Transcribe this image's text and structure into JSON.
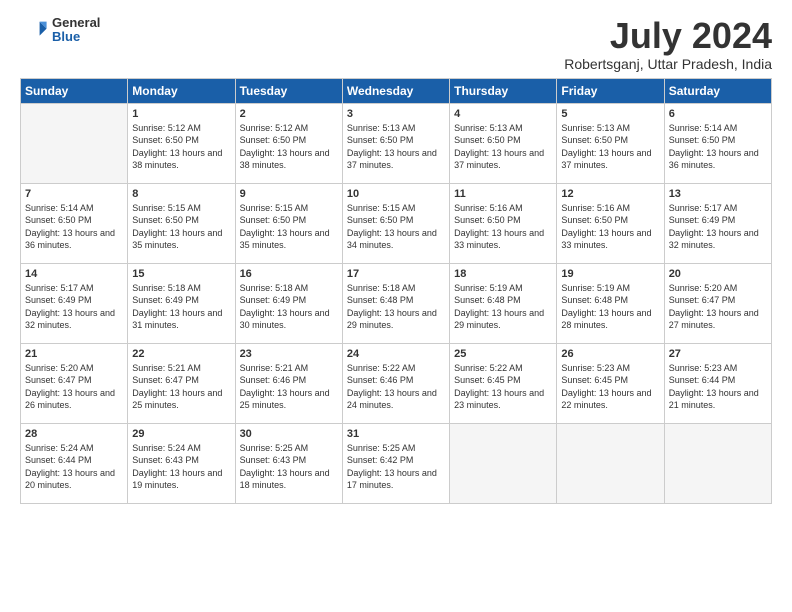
{
  "header": {
    "logo_general": "General",
    "logo_blue": "Blue",
    "title": "July 2024",
    "subtitle": "Robertsganj, Uttar Pradesh, India"
  },
  "days_of_week": [
    "Sunday",
    "Monday",
    "Tuesday",
    "Wednesday",
    "Thursday",
    "Friday",
    "Saturday"
  ],
  "weeks": [
    [
      {
        "day": "",
        "empty": true
      },
      {
        "day": "1",
        "sunrise": "5:12 AM",
        "sunset": "6:50 PM",
        "daylight": "13 hours and 38 minutes."
      },
      {
        "day": "2",
        "sunrise": "5:12 AM",
        "sunset": "6:50 PM",
        "daylight": "13 hours and 38 minutes."
      },
      {
        "day": "3",
        "sunrise": "5:13 AM",
        "sunset": "6:50 PM",
        "daylight": "13 hours and 37 minutes."
      },
      {
        "day": "4",
        "sunrise": "5:13 AM",
        "sunset": "6:50 PM",
        "daylight": "13 hours and 37 minutes."
      },
      {
        "day": "5",
        "sunrise": "5:13 AM",
        "sunset": "6:50 PM",
        "daylight": "13 hours and 37 minutes."
      },
      {
        "day": "6",
        "sunrise": "5:14 AM",
        "sunset": "6:50 PM",
        "daylight": "13 hours and 36 minutes."
      }
    ],
    [
      {
        "day": "7",
        "sunrise": "5:14 AM",
        "sunset": "6:50 PM",
        "daylight": "13 hours and 36 minutes."
      },
      {
        "day": "8",
        "sunrise": "5:15 AM",
        "sunset": "6:50 PM",
        "daylight": "13 hours and 35 minutes."
      },
      {
        "day": "9",
        "sunrise": "5:15 AM",
        "sunset": "6:50 PM",
        "daylight": "13 hours and 35 minutes."
      },
      {
        "day": "10",
        "sunrise": "5:15 AM",
        "sunset": "6:50 PM",
        "daylight": "13 hours and 34 minutes."
      },
      {
        "day": "11",
        "sunrise": "5:16 AM",
        "sunset": "6:50 PM",
        "daylight": "13 hours and 33 minutes."
      },
      {
        "day": "12",
        "sunrise": "5:16 AM",
        "sunset": "6:50 PM",
        "daylight": "13 hours and 33 minutes."
      },
      {
        "day": "13",
        "sunrise": "5:17 AM",
        "sunset": "6:49 PM",
        "daylight": "13 hours and 32 minutes."
      }
    ],
    [
      {
        "day": "14",
        "sunrise": "5:17 AM",
        "sunset": "6:49 PM",
        "daylight": "13 hours and 32 minutes."
      },
      {
        "day": "15",
        "sunrise": "5:18 AM",
        "sunset": "6:49 PM",
        "daylight": "13 hours and 31 minutes."
      },
      {
        "day": "16",
        "sunrise": "5:18 AM",
        "sunset": "6:49 PM",
        "daylight": "13 hours and 30 minutes."
      },
      {
        "day": "17",
        "sunrise": "5:18 AM",
        "sunset": "6:48 PM",
        "daylight": "13 hours and 29 minutes."
      },
      {
        "day": "18",
        "sunrise": "5:19 AM",
        "sunset": "6:48 PM",
        "daylight": "13 hours and 29 minutes."
      },
      {
        "day": "19",
        "sunrise": "5:19 AM",
        "sunset": "6:48 PM",
        "daylight": "13 hours and 28 minutes."
      },
      {
        "day": "20",
        "sunrise": "5:20 AM",
        "sunset": "6:47 PM",
        "daylight": "13 hours and 27 minutes."
      }
    ],
    [
      {
        "day": "21",
        "sunrise": "5:20 AM",
        "sunset": "6:47 PM",
        "daylight": "13 hours and 26 minutes."
      },
      {
        "day": "22",
        "sunrise": "5:21 AM",
        "sunset": "6:47 PM",
        "daylight": "13 hours and 25 minutes."
      },
      {
        "day": "23",
        "sunrise": "5:21 AM",
        "sunset": "6:46 PM",
        "daylight": "13 hours and 25 minutes."
      },
      {
        "day": "24",
        "sunrise": "5:22 AM",
        "sunset": "6:46 PM",
        "daylight": "13 hours and 24 minutes."
      },
      {
        "day": "25",
        "sunrise": "5:22 AM",
        "sunset": "6:45 PM",
        "daylight": "13 hours and 23 minutes."
      },
      {
        "day": "26",
        "sunrise": "5:23 AM",
        "sunset": "6:45 PM",
        "daylight": "13 hours and 22 minutes."
      },
      {
        "day": "27",
        "sunrise": "5:23 AM",
        "sunset": "6:44 PM",
        "daylight": "13 hours and 21 minutes."
      }
    ],
    [
      {
        "day": "28",
        "sunrise": "5:24 AM",
        "sunset": "6:44 PM",
        "daylight": "13 hours and 20 minutes."
      },
      {
        "day": "29",
        "sunrise": "5:24 AM",
        "sunset": "6:43 PM",
        "daylight": "13 hours and 19 minutes."
      },
      {
        "day": "30",
        "sunrise": "5:25 AM",
        "sunset": "6:43 PM",
        "daylight": "13 hours and 18 minutes."
      },
      {
        "day": "31",
        "sunrise": "5:25 AM",
        "sunset": "6:42 PM",
        "daylight": "13 hours and 17 minutes."
      },
      {
        "day": "",
        "empty": true
      },
      {
        "day": "",
        "empty": true
      },
      {
        "day": "",
        "empty": true
      }
    ]
  ]
}
